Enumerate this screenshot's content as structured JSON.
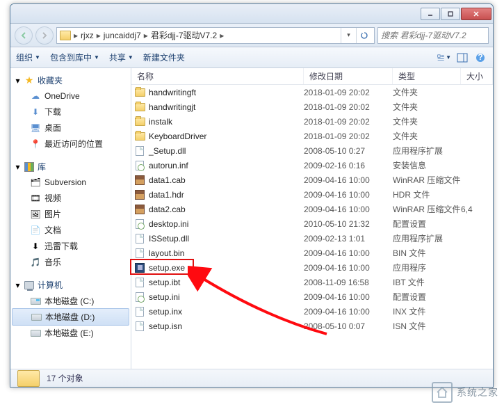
{
  "window": {
    "breadcrumb": [
      "rjxz",
      "juncaiddj7",
      "君彩djj-7驱动V7.2"
    ],
    "search_placeholder": "搜索 君彩djj-7驱动V7.2"
  },
  "toolbar": {
    "organize": "组织",
    "include": "包含到库中",
    "share": "共享",
    "newfolder": "新建文件夹"
  },
  "nav": {
    "favorites": {
      "label": "收藏夹",
      "items": [
        "OneDrive",
        "下载",
        "桌面",
        "最近访问的位置"
      ]
    },
    "libraries": {
      "label": "库",
      "items": [
        "Subversion",
        "视频",
        "图片",
        "文档",
        "迅雷下载",
        "音乐"
      ]
    },
    "computer": {
      "label": "计算机",
      "items": [
        "本地磁盘 (C:)",
        "本地磁盘 (D:)",
        "本地磁盘 (E:)"
      ],
      "selected": 1
    }
  },
  "columns": {
    "name": "名称",
    "date": "修改日期",
    "type": "类型",
    "size": "大小"
  },
  "files": [
    {
      "icon": "folder",
      "name": "handwritingft",
      "date": "2018-01-09 20:02",
      "type": "文件夹",
      "size": ""
    },
    {
      "icon": "folder",
      "name": "handwritingjt",
      "date": "2018-01-09 20:02",
      "type": "文件夹",
      "size": ""
    },
    {
      "icon": "folder",
      "name": "instalk",
      "date": "2018-01-09 20:02",
      "type": "文件夹",
      "size": ""
    },
    {
      "icon": "folder",
      "name": "KeyboardDriver",
      "date": "2018-01-09 20:02",
      "type": "文件夹",
      "size": ""
    },
    {
      "icon": "file",
      "name": "_Setup.dll",
      "date": "2008-05-10 0:27",
      "type": "应用程序扩展",
      "size": ""
    },
    {
      "icon": "ini",
      "name": "autorun.inf",
      "date": "2009-02-16 0:16",
      "type": "安装信息",
      "size": ""
    },
    {
      "icon": "rar",
      "name": "data1.cab",
      "date": "2009-04-16 10:00",
      "type": "WinRAR 压缩文件",
      "size": ""
    },
    {
      "icon": "rar",
      "name": "data1.hdr",
      "date": "2009-04-16 10:00",
      "type": "HDR 文件",
      "size": ""
    },
    {
      "icon": "rar",
      "name": "data2.cab",
      "date": "2009-04-16 10:00",
      "type": "WinRAR 压缩文件",
      "size": "6,4"
    },
    {
      "icon": "ini",
      "name": "desktop.ini",
      "date": "2010-05-10 21:32",
      "type": "配置设置",
      "size": ""
    },
    {
      "icon": "file",
      "name": "ISSetup.dll",
      "date": "2009-02-13 1:01",
      "type": "应用程序扩展",
      "size": ""
    },
    {
      "icon": "file",
      "name": "layout.bin",
      "date": "2009-04-16 10:00",
      "type": "BIN 文件",
      "size": ""
    },
    {
      "icon": "exe",
      "name": "setup.exe",
      "date": "2009-04-16 10:00",
      "type": "应用程序",
      "size": "",
      "highlight": true
    },
    {
      "icon": "file",
      "name": "setup.ibt",
      "date": "2008-11-09 16:58",
      "type": "IBT 文件",
      "size": ""
    },
    {
      "icon": "ini",
      "name": "setup.ini",
      "date": "2009-04-16 10:00",
      "type": "配置设置",
      "size": ""
    },
    {
      "icon": "file",
      "name": "setup.inx",
      "date": "2009-04-16 10:00",
      "type": "INX 文件",
      "size": ""
    },
    {
      "icon": "file",
      "name": "setup.isn",
      "date": "2008-05-10 0:07",
      "type": "ISN 文件",
      "size": ""
    }
  ],
  "status": {
    "count_text": "17 个对象"
  },
  "watermark": {
    "text": "系统之家",
    "url": "xTongZhiJia.NET"
  },
  "highlight_color": "#e01010",
  "arrow_color": "#ff0a10"
}
